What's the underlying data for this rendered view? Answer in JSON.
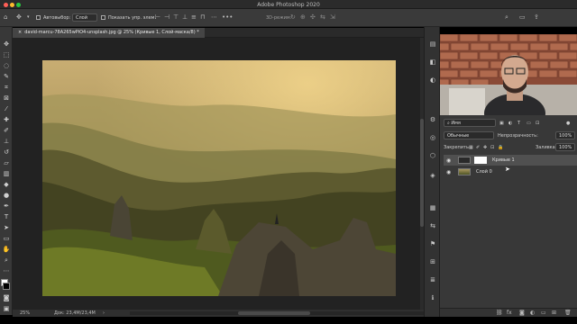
{
  "window": {
    "title": "Adobe Photoshop 2020"
  },
  "options_bar": {
    "autoselect_label": "Автовыбор:",
    "autoselect_value": "Слой",
    "show_transform_label": "Показать упр. элем.",
    "mode_3d_label": "3D-режим:"
  },
  "document": {
    "tab_label": "david-marcu-78A265wPiO4-unsplash.jpg @ 25% (Кривые 1, Слой-маска/8) *",
    "zoom": "25%",
    "doc_size": "Док: 23,4M/23,4M"
  },
  "layers_panel": {
    "search_placeholder": "Имя",
    "blend_mode": "Обычные",
    "opacity_label": "Непрозрачность:",
    "opacity_value": "100%",
    "lock_label": "Закрепить:",
    "fill_label": "Заливка:",
    "fill_value": "100%",
    "layers": [
      {
        "name": "Кривые 1",
        "active": true
      },
      {
        "name": "Слой 0",
        "active": false
      }
    ]
  },
  "colors": {
    "accent": "#3d7be0",
    "panel_bg": "#383838",
    "canvas_bg": "#222222"
  }
}
